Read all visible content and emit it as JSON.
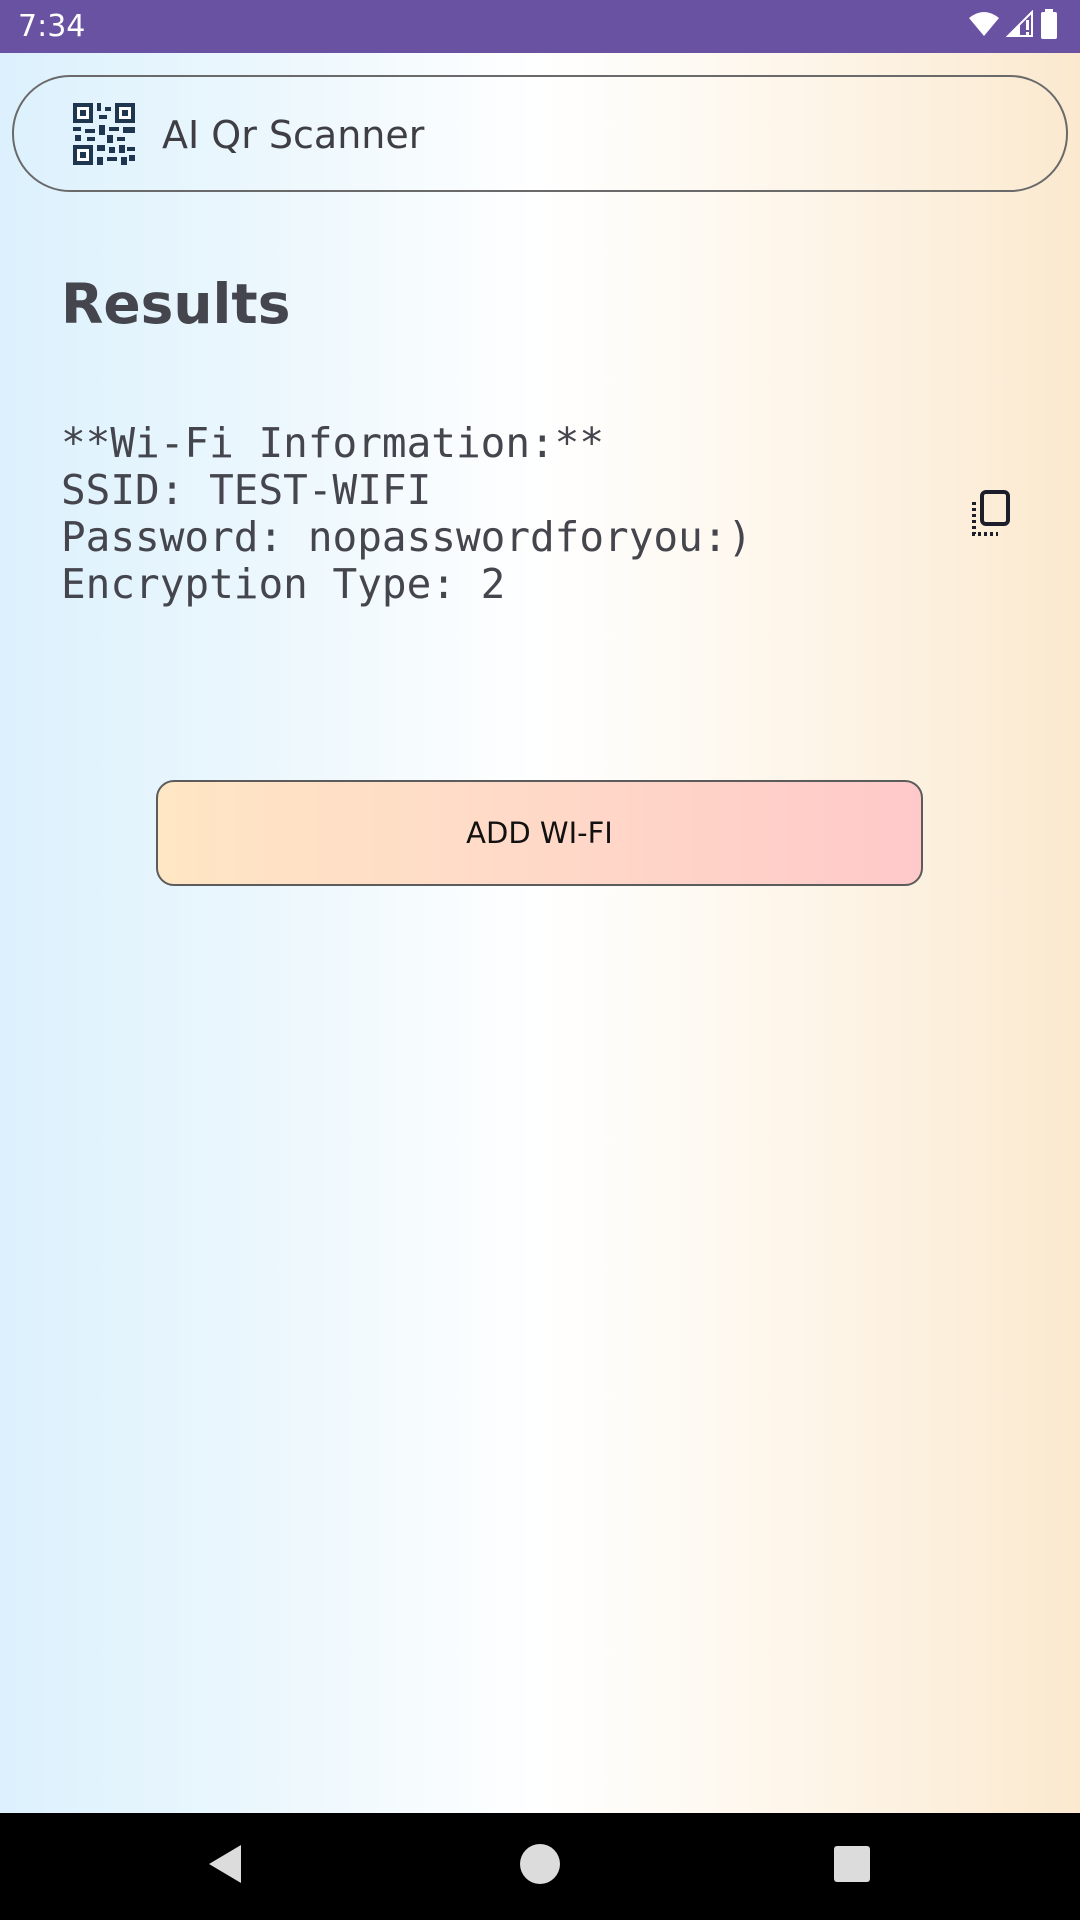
{
  "status_bar": {
    "time": "7:34",
    "icons": [
      "wifi-icon",
      "signal-icon",
      "battery-icon"
    ]
  },
  "app_bar": {
    "logo_icon": "qr-code-icon",
    "title": "AI Qr Scanner"
  },
  "main": {
    "heading": "Results",
    "result_lines": [
      "**Wi-Fi Information:**",
      "SSID: TEST-WIFI",
      "Password: nopasswordforyou:)",
      "Encryption Type: 2"
    ],
    "copy_icon": "copy-icon",
    "add_wifi_label": "ADD WI-FI"
  },
  "nav_bar": {
    "icons": [
      "back-icon",
      "home-icon",
      "recents-icon"
    ]
  },
  "colors": {
    "status_bar": "#6a52a3",
    "text": "#45454d",
    "button_start": "#ffe6c4",
    "button_end": "#ffc9c9"
  }
}
